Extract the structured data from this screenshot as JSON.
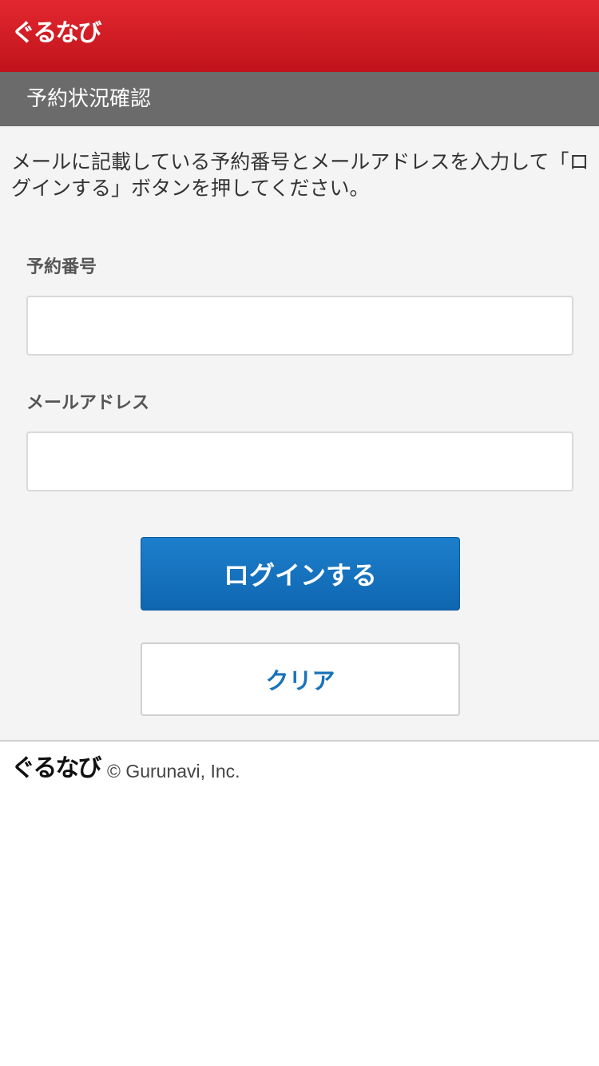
{
  "header": {
    "logo_text": "ぐるなび",
    "brand_color": "#d01c24"
  },
  "subheader": {
    "title": "予約状況確認"
  },
  "main": {
    "intro_text": "メールに記載している予約番号とメールアドレスを入力して「ログインする」ボタンを押してください。",
    "reservation_field": {
      "label": "予約番号",
      "value": "",
      "placeholder": ""
    },
    "email_field": {
      "label": "メールアドレス",
      "value": "",
      "placeholder": ""
    },
    "login_button_label": "ログインする",
    "clear_button_label": "クリア",
    "login_button_color": "#1570bd",
    "clear_button_text_color": "#1a73b8"
  },
  "footer": {
    "logo_text": "ぐるなび",
    "copyright": "© Gurunavi, Inc."
  }
}
